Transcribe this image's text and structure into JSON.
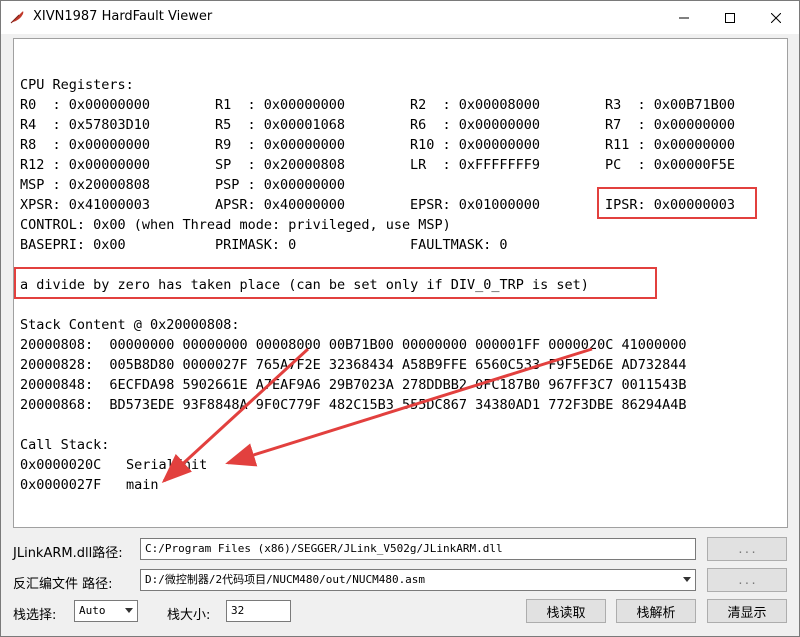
{
  "window": {
    "title": "XIVN1987 HardFault Viewer"
  },
  "output": {
    "cpu_header": "CPU Registers:",
    "registers": [
      [
        "R0  : 0x00000000",
        "R1  : 0x00000000",
        "R2  : 0x00008000",
        "R3  : 0x00B71B00"
      ],
      [
        "R4  : 0x57803D10",
        "R5  : 0x00001068",
        "R6  : 0x00000000",
        "R7  : 0x00000000"
      ],
      [
        "R8  : 0x00000000",
        "R9  : 0x00000000",
        "R10 : 0x00000000",
        "R11 : 0x00000000"
      ],
      [
        "R12 : 0x00000000",
        "SP  : 0x20000808",
        "LR  : 0xFFFFFFF9",
        "PC  : 0x00000F5E"
      ],
      [
        "MSP : 0x20000808",
        "PSP : 0x00000000",
        "",
        ""
      ],
      [
        "XPSR: 0x41000003",
        "APSR: 0x40000000",
        "EPSR: 0x01000000",
        "IPSR: 0x00000003"
      ]
    ],
    "control_line": "CONTROL: 0x00 (when Thread mode: privileged, use MSP)",
    "basepri": "BASEPRI: 0x00",
    "primask": "PRIMASK: 0",
    "faultmask": "FAULTMASK: 0",
    "fault_message": "a divide by zero has taken place (can be set only if DIV_0_TRP is set)",
    "stack_header": "Stack Content @ 0x20000808:",
    "stack_rows": [
      "20000808:  00000000 00000000 00008000 00B71B00 00000000 000001FF 0000020C 41000000",
      "20000828:  005B8D80 0000027F 765A7F2E 32368434 A58B9FFE 6560C533 F9F5ED6E AD732844",
      "20000848:  6ECFDA98 5902661E A7EAF9A6 29B7023A 278DDBB2 0FC187B0 967FF3C7 0011543B",
      "20000868:  BD573EDE 93F8848A 9F0C779F 482C15B3 555DC867 34380AD1 772F3DBE 86294A4B"
    ],
    "callstack_header": "Call Stack:",
    "callstack": [
      {
        "addr": "0x0000020C",
        "func": "SerialInit"
      },
      {
        "addr": "0x0000027F",
        "func": "main"
      }
    ]
  },
  "controls": {
    "jlink_label": "JLinkARM.dll路径:",
    "jlink_path": "C:/Program Files (x86)/SEGGER/JLink_V502g/JLinkARM.dll",
    "browse1": "...",
    "disasm_label": "反汇编文件  路径:",
    "disasm_path": "D:/微控制器/2代码项目/NUCM480/out/NUCM480.asm",
    "browse2": "...",
    "stack_select_label": "栈选择:",
    "stack_select_value": "Auto",
    "stack_size_label": "栈大小:",
    "stack_size_value": "32",
    "read_stack": "栈读取",
    "parse_stack": "栈解析",
    "clear": "清显示"
  },
  "colors": {
    "highlight": "#e2403e"
  }
}
